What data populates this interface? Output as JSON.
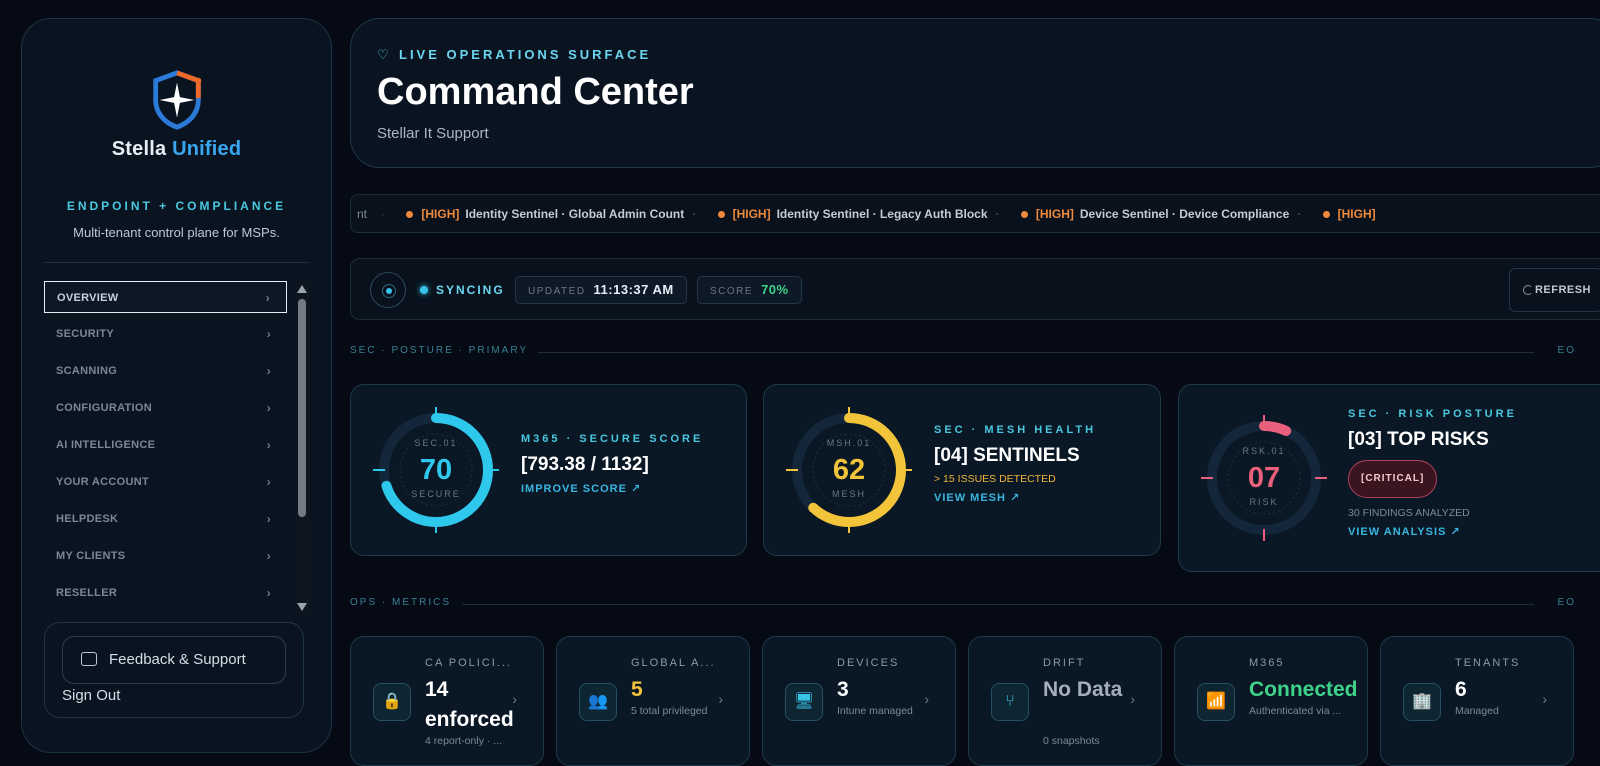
{
  "sidebar": {
    "brand_part1": "Stella",
    "brand_part2": "Unified",
    "tagline": "ENDPOINT + COMPLIANCE",
    "description": "Multi-tenant control plane for MSPs.",
    "items": [
      {
        "label": "OVERVIEW"
      },
      {
        "label": "SECURITY"
      },
      {
        "label": "SCANNING"
      },
      {
        "label": "CONFIGURATION"
      },
      {
        "label": "AI INTELLIGENCE"
      },
      {
        "label": "YOUR ACCOUNT"
      },
      {
        "label": "HELPDESK"
      },
      {
        "label": "MY CLIENTS"
      },
      {
        "label": "RESELLER"
      }
    ],
    "chevron": "›",
    "feedback_label": "Feedback & Support",
    "signout_label": "Sign Out"
  },
  "hero": {
    "eyebrow": "LIVE OPERATIONS SURFACE",
    "title": "Command Center",
    "subtitle": "Stellar It Support"
  },
  "ticker": {
    "lead": "nt",
    "items": [
      {
        "level": "[HIGH]",
        "text": "Identity Sentinel · Global Admin Count"
      },
      {
        "level": "[HIGH]",
        "text": "Identity Sentinel · Legacy Auth Block"
      },
      {
        "level": "[HIGH]",
        "text": "Device Sentinel · Device Compliance"
      },
      {
        "level": "[HIGH]",
        "text": ""
      }
    ],
    "separator": "·"
  },
  "status": {
    "sync_label": "SYNCING",
    "updated_key": "UPDATED",
    "updated_value": "11:13:37 AM",
    "score_key": "SCORE",
    "score_value": "70%",
    "refresh_label": "REFRESH"
  },
  "sections": {
    "primary": "SEC · POSTURE · PRIMARY",
    "primary_end": "EO",
    "ops": "OPS · METRICS",
    "ops_end": "EO"
  },
  "cards": [
    {
      "gauge_id": "SEC.01",
      "gauge_value": "70",
      "gauge_label": "SECURE",
      "level": 0.7,
      "color": "#2ec8ec",
      "kicker": "M365 · SECURE SCORE",
      "value": "[793.38 / 1132]",
      "link": "IMPROVE SCORE ↗"
    },
    {
      "gauge_id": "MSH.01",
      "gauge_value": "62",
      "gauge_label": "MESH",
      "level": 0.62,
      "color": "#f2c43a",
      "kicker": "SEC · MESH HEALTH",
      "value": "[04] SENTINELS",
      "note": "> 15 ISSUES DETECTED",
      "link": "VIEW MESH ↗"
    },
    {
      "gauge_id": "RSK.01",
      "gauge_value": "07",
      "gauge_label": "RISK",
      "level": 0.07,
      "color": "#e8607c",
      "kicker": "SEC · RISK POSTURE",
      "value": "[03] TOP RISKS",
      "badge": "[CRITICAL]",
      "sub": "30 FINDINGS ANALYZED",
      "link": "VIEW ANALYSIS ↗"
    }
  ],
  "metrics": [
    {
      "icon": "lock-icon",
      "glyph": "🔒",
      "label": "CA POLICI...",
      "value": "14 enforced",
      "sub": "4 report-only · ..."
    },
    {
      "icon": "users-icon",
      "glyph": "👥",
      "label": "GLOBAL A...",
      "value": "5",
      "sub": "5 total privileged",
      "accent": "#f2c43a"
    },
    {
      "icon": "monitor-icon",
      "glyph": "🖥",
      "label": "DEVICES",
      "value": "3",
      "sub": "Intune managed"
    },
    {
      "icon": "git-branch-icon",
      "glyph": "⑂",
      "label": "DRIFT",
      "value": "No Data",
      "sub": "0 snapshots"
    },
    {
      "icon": "wifi-icon",
      "glyph": "📶",
      "label": "M365",
      "value": "Connected",
      "sub": "Authenticated via ...",
      "accent": "#3fd38a"
    },
    {
      "icon": "building-icon",
      "glyph": "🏢",
      "label": "TENANTS",
      "value": "6",
      "sub": "Managed"
    }
  ]
}
